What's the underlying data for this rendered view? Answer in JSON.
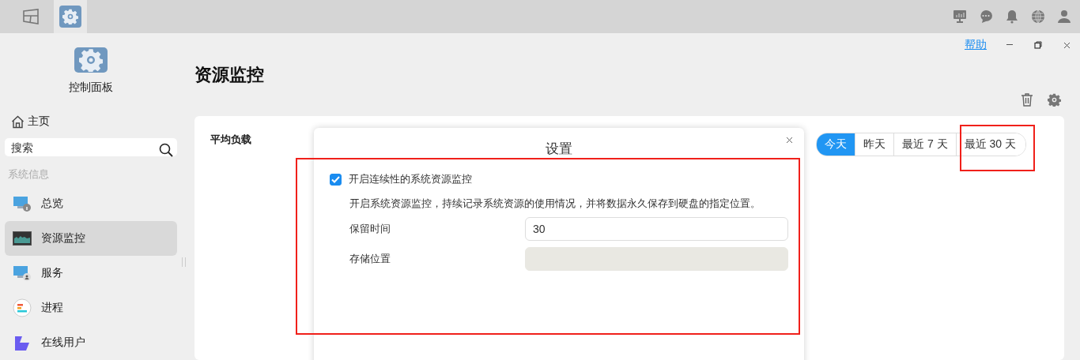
{
  "taskbar": {
    "apps": [
      {
        "kind": "window",
        "selected": false
      },
      {
        "kind": "settings",
        "selected": true
      }
    ]
  },
  "sidebar": {
    "app_title": "控制面板",
    "home": "主页",
    "search": {
      "placeholder": "搜索"
    },
    "section": "系统信息",
    "items": [
      {
        "label": "总览",
        "kind": "overview",
        "selected": false
      },
      {
        "label": "资源监控",
        "kind": "monitor",
        "selected": true
      },
      {
        "label": "服务",
        "kind": "service",
        "selected": false
      },
      {
        "label": "进程",
        "kind": "process",
        "selected": false
      },
      {
        "label": "在线用户",
        "kind": "users",
        "selected": false
      }
    ]
  },
  "header": {
    "help": "帮助",
    "title": "资源监控"
  },
  "card": {
    "label": "平均负载",
    "ranges": [
      {
        "label": "今天",
        "selected": true
      },
      {
        "label": "昨天",
        "selected": false
      },
      {
        "label": "最近 7 天",
        "selected": false
      },
      {
        "label": "最近 30 天",
        "selected": false
      }
    ]
  },
  "dialog": {
    "title": "设置",
    "option": {
      "label": "开启连续性的系统资源监控",
      "checked": true
    },
    "description": "开启系统资源监控，持续记录系统资源的使用情况，并将数据永久保存到硬盘的指定位置。",
    "fields": [
      {
        "label": "保留时间",
        "value": "30",
        "disabled": false
      },
      {
        "label": "存储位置",
        "disabled": true
      }
    ]
  }
}
